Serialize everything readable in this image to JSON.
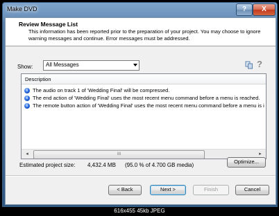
{
  "window": {
    "title": "Make DVD",
    "help_glyph": "?",
    "close_glyph": "X"
  },
  "header": {
    "title": "Review Message List",
    "description": "This information has been reported prior to the preparation of your project. You may choose to ignore warning messages and continue. Error messages must be addressed."
  },
  "filter": {
    "label": "Show:",
    "selected": "All Messages",
    "help_glyph": "?"
  },
  "messages": {
    "column_header": "Description",
    "rows": [
      {
        "icon": "info-icon",
        "text": "The audio on track 1 of 'Wedding Final' will be compressed."
      },
      {
        "icon": "info-icon",
        "text": "The end action of 'Wedding Final' uses the most recent menu command before a menu is reached."
      },
      {
        "icon": "info-icon",
        "text": "The remote button action of 'Wedding Final' uses the most recent menu command before a menu is i"
      }
    ],
    "scroll_left": "◂",
    "scroll_right": "▸",
    "thumb_grip": "III"
  },
  "estimate": {
    "label": "Estimated project size:",
    "value": "4,432.4 MB",
    "percent": "(95.0 % of 4.700 GB media)"
  },
  "buttons": {
    "optimize": "Optimize...",
    "back": "< Back",
    "next": "Next >",
    "finish": "Finish",
    "cancel": "Cancel"
  },
  "caption": "616x455 45kb JPEG",
  "colors": {
    "titlebar": "#6f95bf",
    "close_button": "#c23a1c",
    "info_icon": "#1d5fd6"
  }
}
